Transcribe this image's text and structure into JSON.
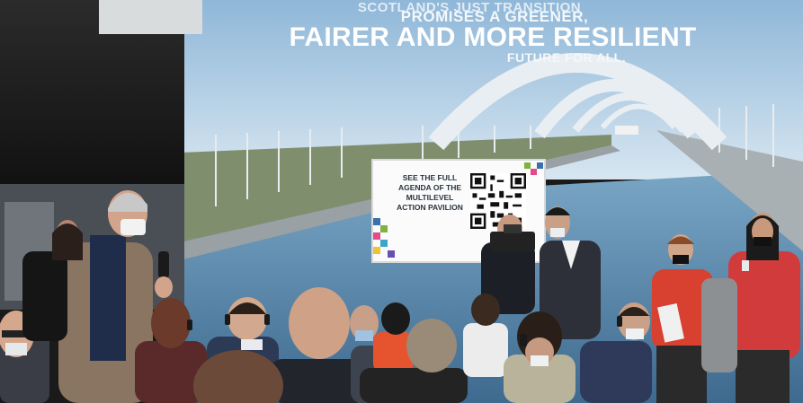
{
  "banner": {
    "line_top": "SCOTLAND'S JUST TRANSITION",
    "line_1": "PROMISES A GREENER,",
    "line_2": "FAIRER AND MORE RESILIENT",
    "line_3": "FUTURE FOR ALL."
  },
  "poster": {
    "title_lines": [
      "SEE THE FULL",
      "AGENDA OF THE",
      "MULTILEVEL",
      "ACTION PAVILION"
    ]
  },
  "colors": {
    "sky": "#bcd6ea",
    "water": "#6a96b8",
    "dark_wall": "#1e1e1e",
    "red_jacket": "#d8402f"
  }
}
